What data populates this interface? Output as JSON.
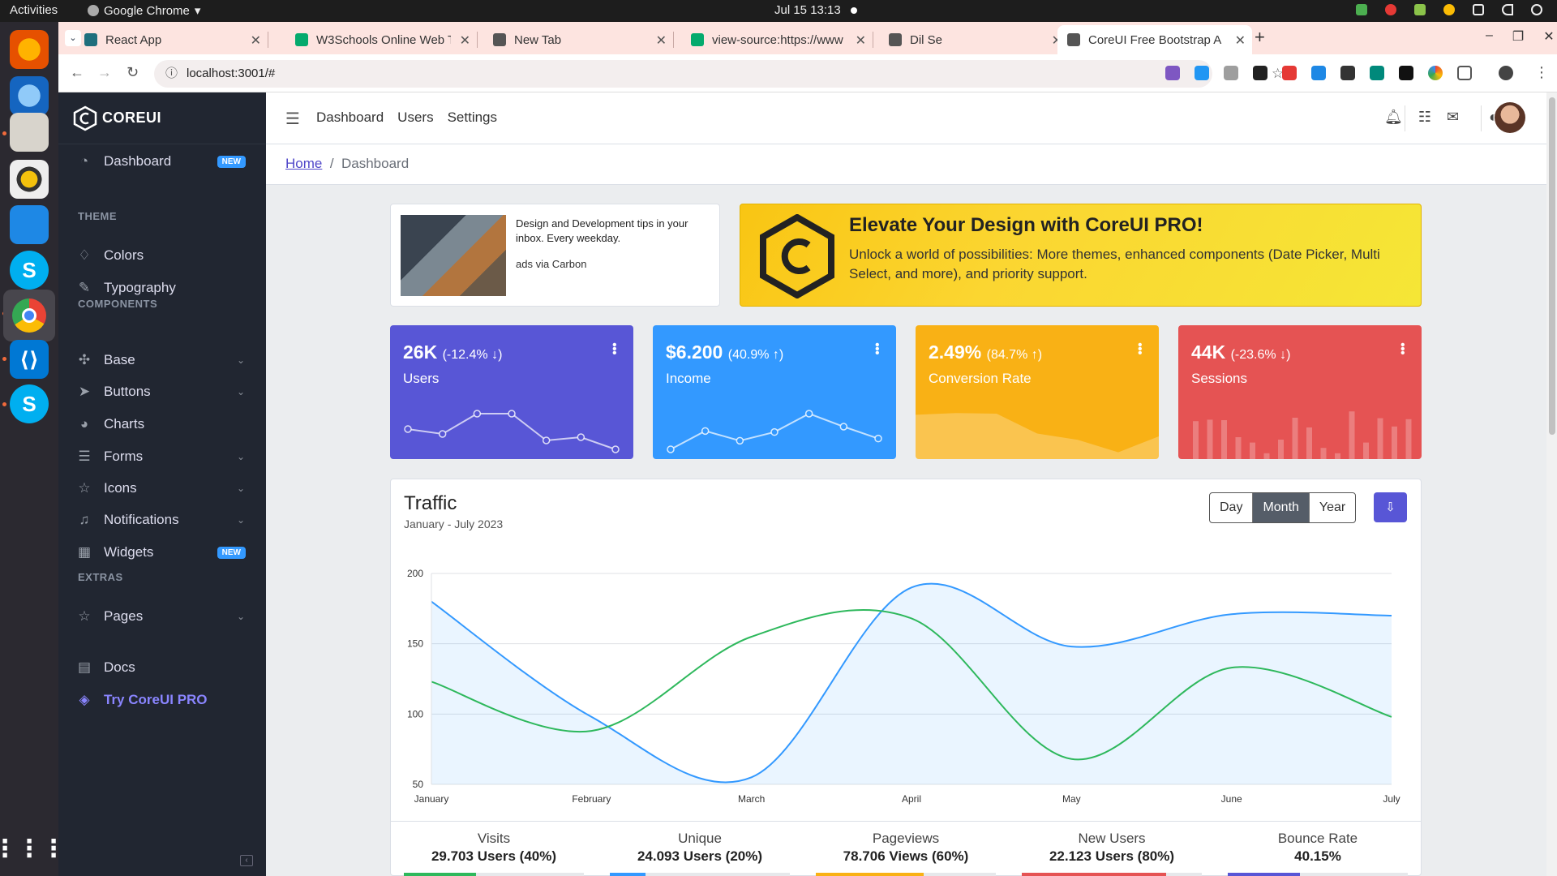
{
  "os": {
    "activities": "Activities",
    "app": "Google Chrome",
    "clock": "Jul 15  13:13"
  },
  "tabs": [
    {
      "title": "React App",
      "color": "#1f6f7d"
    },
    {
      "title": "W3Schools Online Web T",
      "color": "#04aa6d"
    },
    {
      "title": "New Tab",
      "color": "#555"
    },
    {
      "title": "view-source:https://www",
      "color": "#04aa6d"
    },
    {
      "title": "Dil Se",
      "color": "#555"
    },
    {
      "title": "CoreUI Free Bootstrap A",
      "color": "#555"
    }
  ],
  "address": {
    "url": "localhost:3001/#"
  },
  "sidebar": {
    "brand": "COREUI",
    "items": [
      {
        "label": "Dashboard",
        "icon": "speedometer-icon",
        "badge": "NEW"
      },
      {
        "section": "THEME"
      },
      {
        "label": "Colors",
        "icon": "drop-icon"
      },
      {
        "label": "Typography",
        "icon": "pencil-icon"
      },
      {
        "section": "COMPONENTS"
      },
      {
        "label": "Base",
        "icon": "puzzle-icon",
        "chev": true
      },
      {
        "label": "Buttons",
        "icon": "cursor-icon",
        "chev": true
      },
      {
        "label": "Charts",
        "icon": "chart-pie-icon"
      },
      {
        "label": "Forms",
        "icon": "notes-icon",
        "chev": true
      },
      {
        "label": "Icons",
        "icon": "star-icon",
        "chev": true
      },
      {
        "label": "Notifications",
        "icon": "bell-icon",
        "chev": true
      },
      {
        "label": "Widgets",
        "icon": "calculator-icon",
        "badge": "NEW"
      },
      {
        "section": "EXTRAS"
      },
      {
        "label": "Pages",
        "icon": "star-icon",
        "chev": true
      },
      {
        "label": "Docs",
        "icon": "description-icon"
      },
      {
        "label": "Try CoreUI PRO",
        "icon": "layers-icon"
      }
    ]
  },
  "header": {
    "nav": [
      "Dashboard",
      "Users",
      "Settings"
    ]
  },
  "breadcrumb": {
    "home": "Home",
    "current": "Dashboard"
  },
  "carbon": {
    "text": "Design and Development tips in your inbox. Every weekday.",
    "via": "ads via Carbon"
  },
  "promo": {
    "title": "Elevate Your Design with CoreUI PRO!",
    "text": "Unlock a world of possibilities: More themes, enhanced components (Date Picker, Multi Select, and more), and priority support."
  },
  "widgets": [
    {
      "value": "26K",
      "change": "(-12.4% ↓)",
      "label": "Users",
      "color": "#5856d6",
      "type": "line",
      "data": [
        65,
        59,
        84,
        84,
        51,
        55,
        40
      ]
    },
    {
      "value": "$6.200",
      "change": "(40.9% ↑)",
      "label": "Income",
      "color": "#3399ff",
      "type": "line",
      "data": [
        1,
        18,
        9,
        17,
        34,
        22,
        11
      ]
    },
    {
      "value": "2.49%",
      "change": "(84.7% ↑)",
      "label": "Conversion Rate",
      "color": "#f9b115",
      "type": "area",
      "data": [
        78,
        81,
        80,
        45,
        34,
        12,
        40
      ]
    },
    {
      "value": "44K",
      "change": "(-23.6% ↓)",
      "label": "Sessions",
      "color": "#e55353",
      "type": "bar",
      "data": [
        78,
        81,
        80,
        45,
        34,
        12,
        40,
        85,
        65,
        23,
        12,
        98,
        34,
        84,
        67,
        82
      ]
    }
  ],
  "traffic": {
    "title": "Traffic",
    "subtitle": "January - July 2023",
    "periods": [
      "Day",
      "Month",
      "Year"
    ],
    "selected_period": "Month"
  },
  "chart_data": {
    "type": "line",
    "categories": [
      "January",
      "February",
      "March",
      "April",
      "May",
      "June",
      "July"
    ],
    "ylim": [
      50,
      200
    ],
    "yticks": [
      50,
      100,
      150,
      200
    ],
    "series": [
      {
        "values": [
          180,
          98,
          55,
          190,
          148,
          171,
          170
        ],
        "color": "#3399ff",
        "fill": true
      },
      {
        "values": [
          123,
          88,
          155,
          168,
          68,
          133,
          98
        ],
        "color": "#2eb85c",
        "fill": false
      }
    ]
  },
  "stats": [
    {
      "title": "Visits",
      "value": "29.703 Users (40%)",
      "color": "#2eb85c",
      "pct": 40
    },
    {
      "title": "Unique",
      "value": "24.093 Users (20%)",
      "color": "#3399ff",
      "pct": 20
    },
    {
      "title": "Pageviews",
      "value": "78.706 Views (60%)",
      "color": "#f9b115",
      "pct": 60
    },
    {
      "title": "New Users",
      "value": "22.123 Users (80%)",
      "color": "#e55353",
      "pct": 80
    },
    {
      "title": "Bounce Rate",
      "value": "40.15%",
      "color": "#5856d6",
      "pct": 40.15
    }
  ]
}
